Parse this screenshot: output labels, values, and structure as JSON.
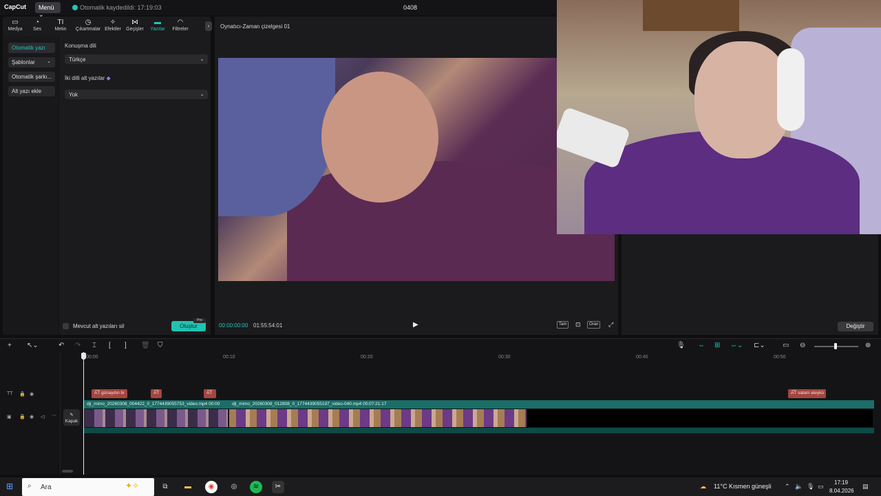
{
  "titlebar": {
    "logo": "CapCut",
    "menu_label": "Menü ⌄",
    "autosave_text": "Otomatik kaydedildi: 17:19:03",
    "project_title": "0408"
  },
  "tool_tabs": [
    {
      "label": "Medya",
      "icon": "media-icon"
    },
    {
      "label": "Ses",
      "icon": "audio-icon"
    },
    {
      "label": "Metin",
      "icon": "text-icon"
    },
    {
      "label": "Çıkartmalar",
      "icon": "sticker-icon"
    },
    {
      "label": "Efektler",
      "icon": "effects-icon"
    },
    {
      "label": "Geçişler",
      "icon": "transitions-icon"
    },
    {
      "label": "Yazılar",
      "icon": "captions-icon",
      "active": true
    },
    {
      "label": "Filtreler",
      "icon": "filters-icon"
    }
  ],
  "captions_sidebar": {
    "items": [
      "Otomatik yazı",
      "Şablonlar",
      "Otomatik şarkı...",
      "Alt yazı ekle"
    ]
  },
  "captions_settings": {
    "language_label": "Konuşma dili",
    "language_value": "Türkçe",
    "bilingual_label": "İki dilli alt yazılar",
    "bilingual_value": "Yok",
    "delete_existing_label": "Mevcut alt yazıları sil",
    "create_label": "Oluştur",
    "pro_badge": "Pro"
  },
  "player": {
    "title": "Oynatıcı-Zaman çizelgesi 01",
    "current_time": "00:00:00:00",
    "total_time": "01:55:54:01",
    "full_label": "Tam",
    "ratio_label": "Oran"
  },
  "right_panel": {
    "change_label": "Değiştir"
  },
  "timeline": {
    "ruler": [
      "00:00",
      "00:10",
      "00:20",
      "00:30",
      "00:40",
      "00:50"
    ],
    "captions": [
      {
        "text": "A͞T günaydın bi"
      },
      {
        "text": "A͞T"
      },
      {
        "text": "A͞T"
      },
      {
        "text": "A͞T salam aleykü"
      }
    ],
    "clips": [
      {
        "label": "dji_mimo_20260308_004422_0_1774439055753_video.mp4   00:00"
      },
      {
        "label": "dji_mimo_20260308_012808_0_1774439055197_video-040.mp4   00:07:21:17"
      }
    ],
    "cover_label": "Kapak"
  },
  "taskbar": {
    "search_placeholder": "Ara",
    "weather": "11°C  Kısmen güneşli",
    "time": "17:19",
    "date": "8.04.2026"
  },
  "colors": {
    "accent": "#22c6b6",
    "caption_clip": "#a3463f",
    "video_track": "#1a6e68"
  }
}
